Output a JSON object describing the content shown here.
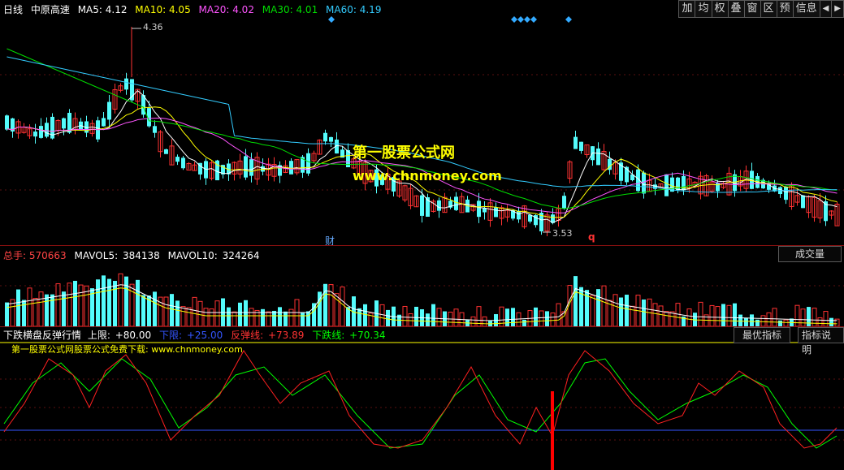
{
  "header": {
    "period": "日线",
    "stock": "中原高速",
    "ma": [
      {
        "label": "MA5: 4.12",
        "color": "#ffffff"
      },
      {
        "label": "MA10: 4.05",
        "color": "#ffff00"
      },
      {
        "label": "MA20: 4.02",
        "color": "#ff55ff"
      },
      {
        "label": "MA30: 4.01",
        "color": "#00dd00"
      },
      {
        "label": "MA60: 4.19",
        "color": "#33ccff"
      }
    ]
  },
  "toolbar": [
    "加",
    "均",
    "权",
    "叠",
    "窗",
    "区",
    "预",
    "信息",
    "◀",
    "▶"
  ],
  "price_labels": {
    "high": "4.36",
    "low": "3.53",
    "cai": "财",
    "q": "q"
  },
  "watermark": {
    "cn": "第一股票公式网",
    "url": "www.chnmoney.com"
  },
  "volume": {
    "total": {
      "label": "总手:",
      "value": "570663",
      "color": "#ff4444"
    },
    "mavol5": {
      "label": "MAVOL5:",
      "value": "384138",
      "color": "#ffffff"
    },
    "mavol10": {
      "label": "MAVOL10:",
      "value": "324264",
      "color": "#ffffff"
    },
    "button": "成交量"
  },
  "indicator": {
    "name": "下跌横盘反弹行情",
    "upper": {
      "label": "上限:",
      "value": "+80.00",
      "color": "#ffffff"
    },
    "lower": {
      "label": "下限:",
      "value": "+25.00",
      "color": "#3355ff"
    },
    "rebound": {
      "label": "反弹线:",
      "value": "+73.89",
      "color": "#ff3333"
    },
    "fall": {
      "label": "下跌线:",
      "value": "+70.34",
      "color": "#00ff00"
    },
    "subtitle": "第一股票公式网股票公式免费下载: www.chnmoney.com",
    "btn_best": "最优指标",
    "btn_desc": "指标说明"
  },
  "colors": {
    "up": "#ff3232",
    "down": "#54fcfc",
    "bg": "#000000"
  }
}
